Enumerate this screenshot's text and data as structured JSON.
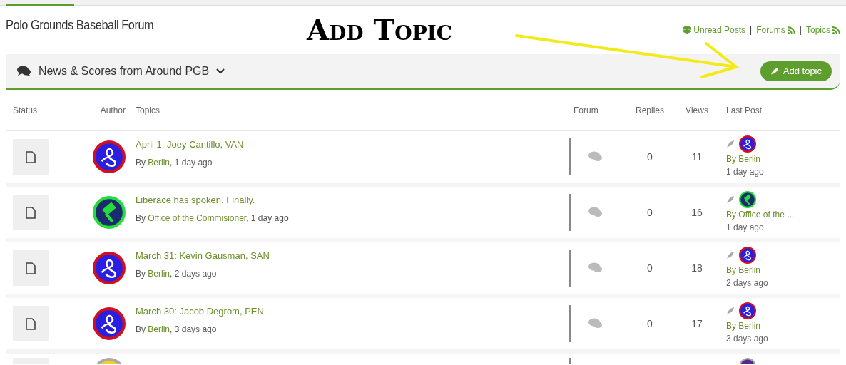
{
  "forum_title": "Polo Grounds Baseball Forum",
  "annotation": {
    "text": "Add Topic"
  },
  "header_links": [
    {
      "kind": "unread",
      "label": "Unread Posts"
    },
    {
      "kind": "feed",
      "separator": "|",
      "label": "Forums"
    },
    {
      "kind": "feed",
      "separator": "|",
      "label": "Topics"
    }
  ],
  "category_bar": {
    "label": "News & Scores from Around PGB",
    "button": "Add topic"
  },
  "table": {
    "columns": [
      "Status",
      "Author",
      "Topics",
      "Forum",
      "Replies",
      "Views",
      "Last Post"
    ],
    "rows": [
      {
        "title": "April 1: Joey Cantillo, VAN",
        "byline": [
          {
            "kind": "text",
            "text": "By "
          },
          {
            "kind": "link",
            "text": "Berlin"
          },
          {
            "kind": "text",
            "text": ", 1 day ago"
          }
        ],
        "replies": "0",
        "views": "11",
        "last_by": "By Berlin",
        "last_when": "1 day ago",
        "kind": "emblem",
        "color": "#2a1ee0"
      },
      {
        "title": "Liberace has spoken. Finally.",
        "byline": [
          {
            "kind": "text",
            "text": "By "
          },
          {
            "kind": "link",
            "text": "Office of the Commisioner"
          },
          {
            "kind": "text",
            "text": ", 1 day ago"
          }
        ],
        "replies": "0",
        "views": "16",
        "last_by": "By Office of the ...",
        "last_when": "1 day ago",
        "kind": "gavel",
        "color": "#1c2a6e"
      },
      {
        "title": "March 31: Kevin Gausman, SAN",
        "byline": [
          {
            "kind": "text",
            "text": "By "
          },
          {
            "kind": "link",
            "text": "Berlin"
          },
          {
            "kind": "text",
            "text": ", 2 days ago"
          }
        ],
        "replies": "0",
        "views": "18",
        "last_by": "By Berlin",
        "last_when": "2 days ago",
        "kind": "emblem",
        "color": "#2a1ee0"
      },
      {
        "title": "March 30: Jacob Degrom, PEN",
        "byline": [
          {
            "kind": "text",
            "text": "By "
          },
          {
            "kind": "link",
            "text": "Berlin"
          },
          {
            "kind": "text",
            "text": ", 3 days ago"
          }
        ],
        "replies": "0",
        "views": "17",
        "last_by": "By Berlin",
        "last_when": "3 days ago",
        "kind": "emblem",
        "color": "#2a1ee0"
      }
    ],
    "partial_row": {
      "avatars": [
        {
          "color": "#f2d21c"
        },
        {
          "color": "#5a2a8a"
        }
      ]
    }
  }
}
